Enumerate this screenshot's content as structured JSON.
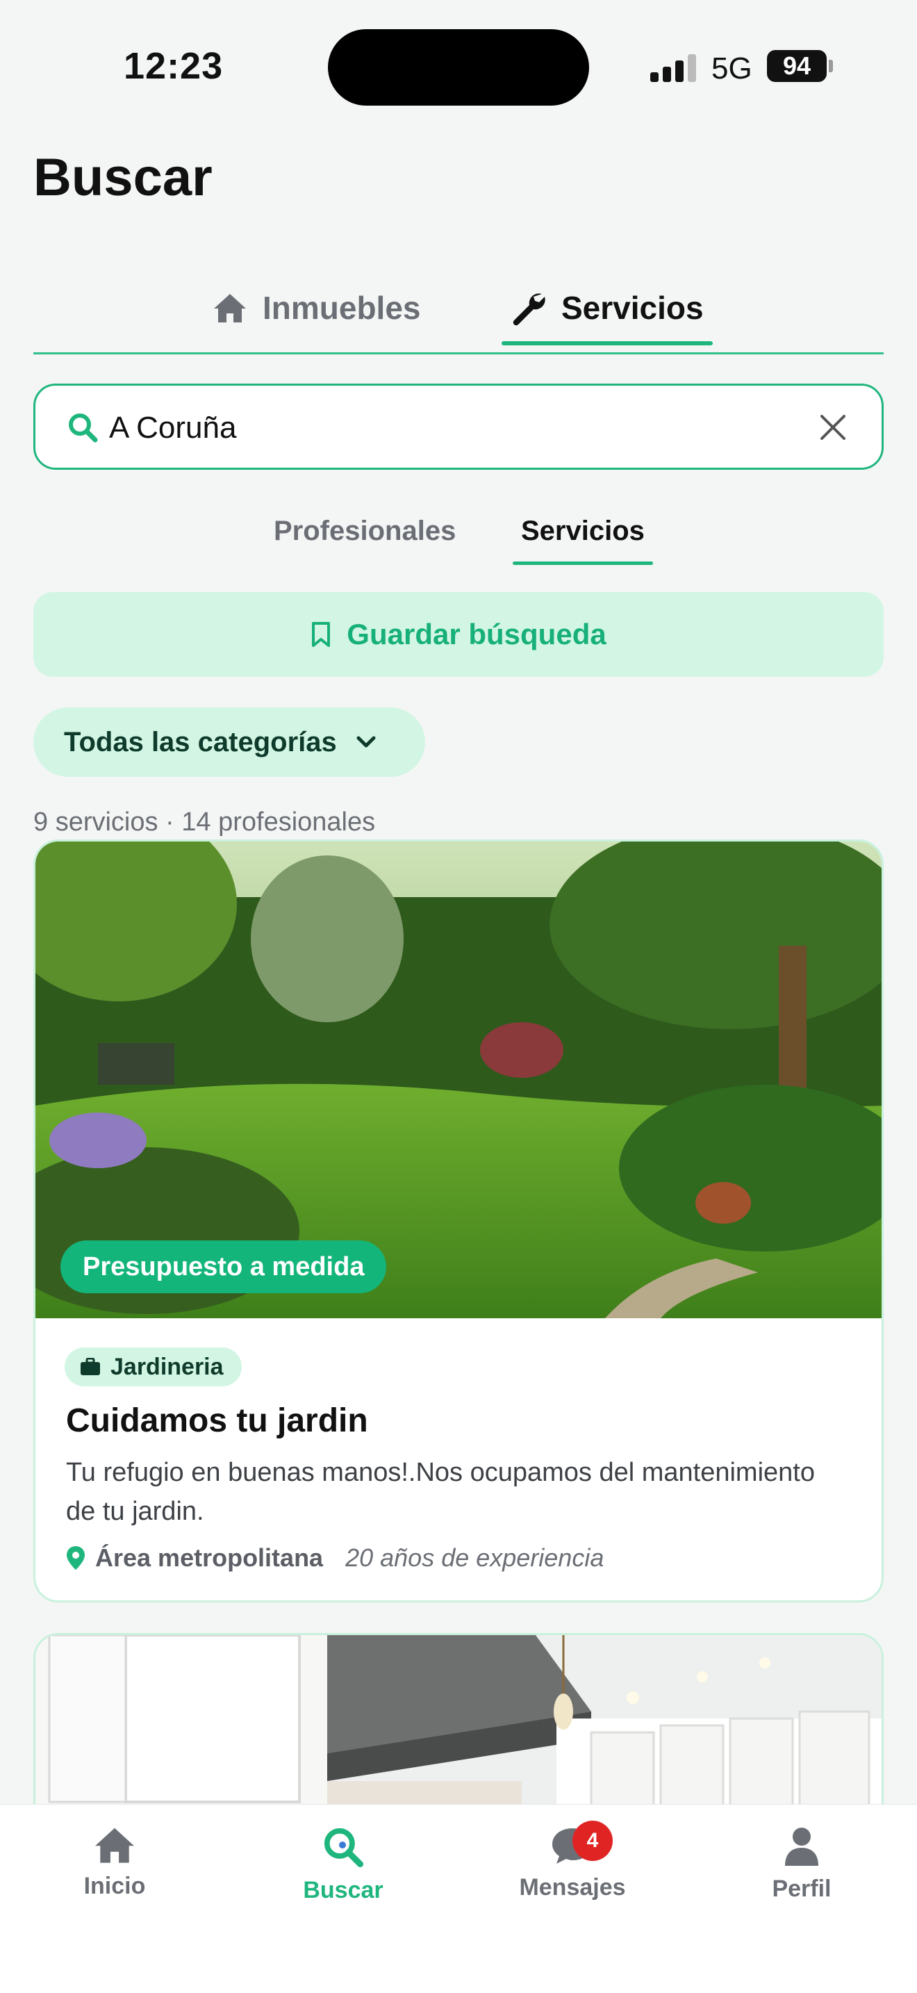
{
  "status_bar": {
    "time": "12:23",
    "network": "5G",
    "battery": "94"
  },
  "page": {
    "title": "Buscar"
  },
  "main_tabs": [
    {
      "label": "Inmuebles",
      "icon": "home-icon",
      "active": false
    },
    {
      "label": "Servicios",
      "icon": "wrench-icon",
      "active": true
    }
  ],
  "search": {
    "value": "A Coruña",
    "placeholder": ""
  },
  "sub_tabs": [
    {
      "label": "Profesionales",
      "active": false
    },
    {
      "label": "Servicios",
      "active": true
    }
  ],
  "save_search": {
    "label": "Guardar búsqueda",
    "icon": "bookmark-icon"
  },
  "category_filter": {
    "label": "Todas las categorías",
    "icon": "chevron-down-icon"
  },
  "results": {
    "summary": "9 servicios · 14 profesionales"
  },
  "cards": [
    {
      "badge": "Presupuesto a medida",
      "category": "Jardineria",
      "title": "Cuidamos tu jardin",
      "description": "Tu refugio en buenas manos!.Nos ocupamos del mantenimiento de tu jardin.",
      "area": "Área metropolitana",
      "experience": "20 años de experiencia"
    }
  ],
  "bottom_nav": [
    {
      "label": "Inicio",
      "icon": "home-icon",
      "active": false
    },
    {
      "label": "Buscar",
      "icon": "search-icon",
      "active": true
    },
    {
      "label": "Mensajes",
      "icon": "chat-icon",
      "active": false,
      "badge": "4"
    },
    {
      "label": "Perfil",
      "icon": "user-icon",
      "active": false
    }
  ],
  "colors": {
    "accent": "#1fb67e",
    "accent_light": "#d3f6e4",
    "badge_red": "#e02424"
  }
}
